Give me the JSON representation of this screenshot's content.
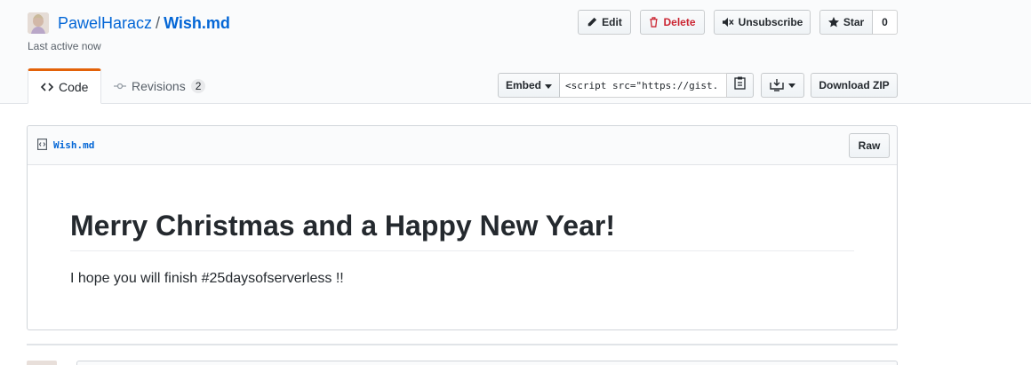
{
  "header": {
    "owner": "PawelHaracz",
    "separator": "/",
    "gist_name": "Wish.md",
    "meta": "Last active now"
  },
  "actions": {
    "edit": "Edit",
    "delete": "Delete",
    "unsubscribe": "Unsubscribe",
    "star": "Star",
    "star_count": "0"
  },
  "tabs": [
    {
      "label": "Code",
      "icon": "code-icon",
      "active": true
    },
    {
      "label": "Revisions",
      "icon": "git-commit-icon",
      "count": "2",
      "active": false
    }
  ],
  "embed": {
    "label": "Embed",
    "value": "<script src=\"https://gist.",
    "download_zip": "Download ZIP"
  },
  "file": {
    "name": "Wish.md",
    "raw": "Raw",
    "heading": "Merry Christmas and a Happy New Year!",
    "paragraph": "I hope you will finish #25daysofserverless !!"
  },
  "colors": {
    "link": "#0366d6",
    "danger": "#cb2431",
    "tab_accent": "#e36209"
  }
}
